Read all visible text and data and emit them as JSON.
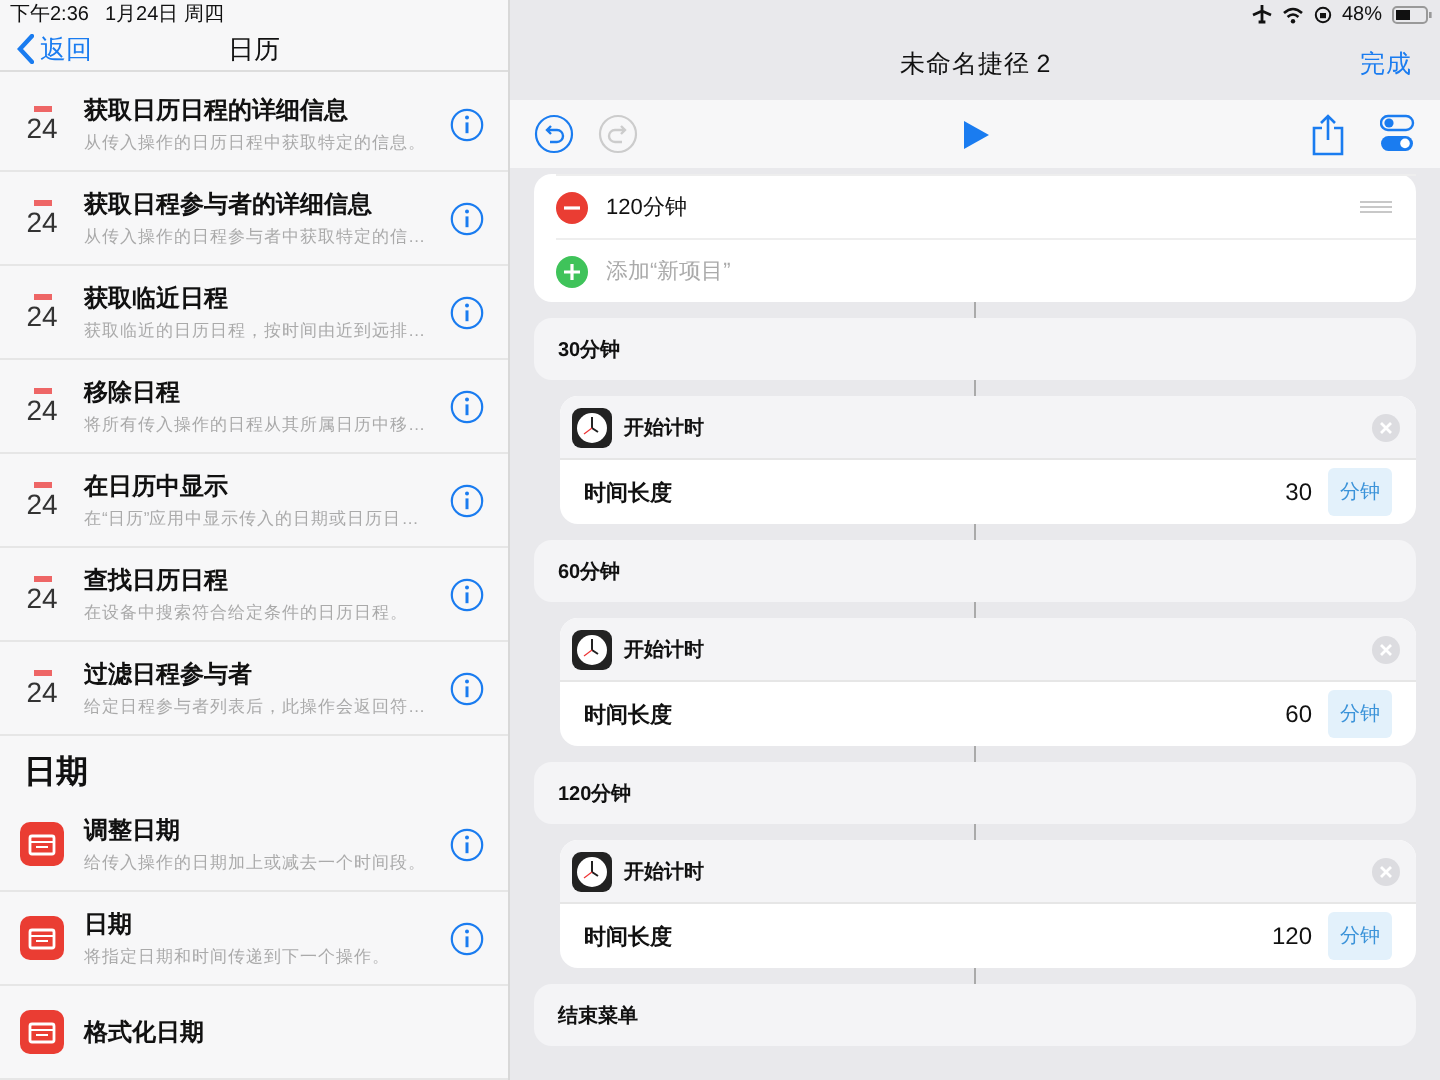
{
  "status_bar": {
    "time": "下午2:36",
    "date": "1月24日 周四",
    "battery": "48%"
  },
  "sidebar": {
    "back": "返回",
    "title": "日历",
    "sections": [
      {
        "items": [
          {
            "kind": "calendar",
            "icon_day": "24",
            "title": "获取日历日程的详细信息",
            "subtitle": "从传入操作的日历日程中获取特定的信息。"
          },
          {
            "kind": "calendar",
            "icon_day": "24",
            "title": "获取日程参与者的详细信息",
            "subtitle": "从传入操作的日程参与者中获取特定的信…"
          },
          {
            "kind": "calendar",
            "icon_day": "24",
            "title": "获取临近日程",
            "subtitle": "获取临近的日历日程，按时间由近到远排…"
          },
          {
            "kind": "calendar",
            "icon_day": "24",
            "title": "移除日程",
            "subtitle": "将所有传入操作的日程从其所属日历中移…"
          },
          {
            "kind": "calendar",
            "icon_day": "24",
            "title": "在日历中显示",
            "subtitle": "在“日历”应用中显示传入的日期或日历日…"
          },
          {
            "kind": "calendar",
            "icon_day": "24",
            "title": "查找日历日程",
            "subtitle": "在设备中搜索符合给定条件的日历日程。"
          },
          {
            "kind": "calendar",
            "icon_day": "24",
            "title": "过滤日程参与者",
            "subtitle": "给定日程参与者列表后，此操作会返回符…"
          }
        ]
      },
      {
        "heading": "日期",
        "items": [
          {
            "kind": "date",
            "title": "调整日期",
            "subtitle": "给传入操作的日期加上或减去一个时间段。"
          },
          {
            "kind": "date",
            "title": "日期",
            "subtitle": "将指定日期和时间传递到下一个操作。"
          },
          {
            "kind": "date",
            "title": "格式化日期"
          }
        ]
      }
    ]
  },
  "editor": {
    "title": "未命名捷径 2",
    "done": "完成",
    "list_items": [
      {
        "kind": "remove",
        "label": "120分钟"
      },
      {
        "kind": "add",
        "placeholder": "添加“新项目”"
      }
    ],
    "blocks": [
      {
        "kind": "case",
        "label": "30分钟"
      },
      {
        "kind": "action",
        "title": "开始计时",
        "param_label": "时间长度",
        "value": "30",
        "unit": "分钟"
      },
      {
        "kind": "case",
        "label": "60分钟"
      },
      {
        "kind": "action",
        "title": "开始计时",
        "param_label": "时间长度",
        "value": "60",
        "unit": "分钟"
      },
      {
        "kind": "case",
        "label": "120分钟"
      },
      {
        "kind": "action",
        "title": "开始计时",
        "param_label": "时间长度",
        "value": "120",
        "unit": "分钟"
      },
      {
        "kind": "end",
        "label": "结束菜单"
      }
    ]
  }
}
